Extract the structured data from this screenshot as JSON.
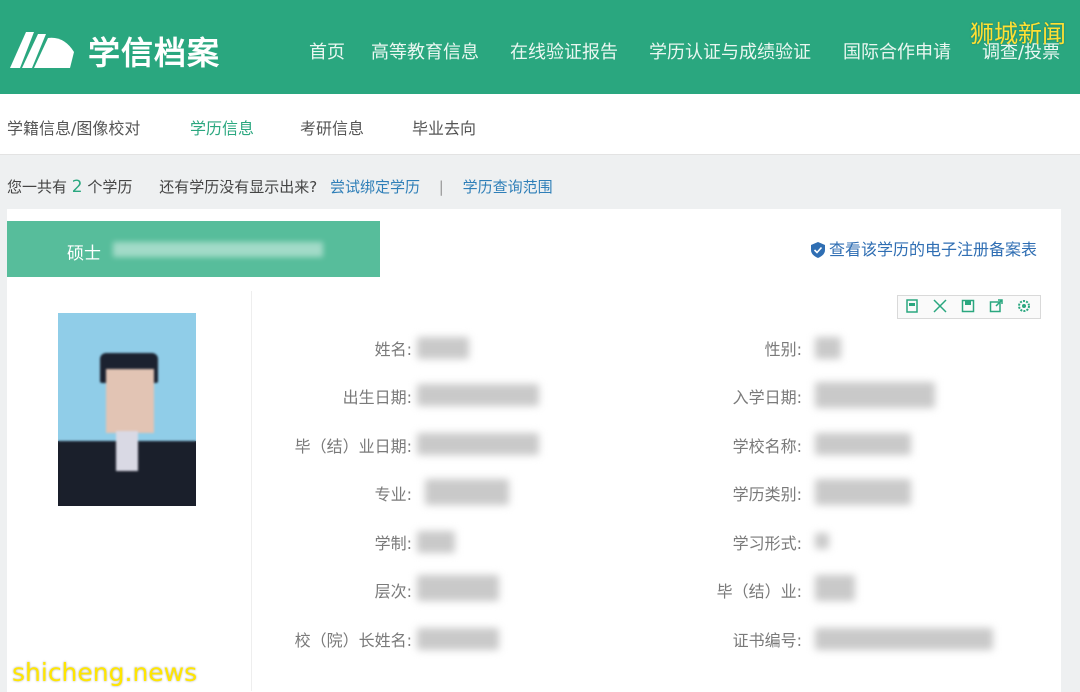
{
  "header": {
    "brand": "学信档案",
    "nav": [
      "首页",
      "高等教育信息",
      "在线验证报告",
      "学历认证与成绩验证",
      "国际合作申请",
      "调查/投票"
    ],
    "watermark": "狮城新闻",
    "accent_color": "#2aa77f"
  },
  "subnav": {
    "items": [
      "学籍信息/图像校对",
      "学历信息",
      "考研信息",
      "毕业去向"
    ],
    "active": "学历信息"
  },
  "summary": {
    "prefix": "您一共有",
    "count": "2",
    "suffix": "个学历",
    "question": "还有学历没有显示出来?",
    "bind_link": "尝试绑定学历",
    "separator": "|",
    "scope_link": "学历查询范围"
  },
  "record": {
    "degree": "硕士",
    "ereg_link": "查看该学历的电子注册备案表",
    "toolbar_icons": [
      "bookmark-icon",
      "fullscreen-icon",
      "save-icon",
      "export-icon",
      "settings-icon"
    ],
    "fields_left": [
      "姓名:",
      "出生日期:",
      "毕（结）业日期:",
      "专业:",
      "学制:",
      "层次:",
      "校（院）长姓名:"
    ],
    "fields_right": [
      "性别:",
      "入学日期:",
      "学校名称:",
      "学历类别:",
      "学习形式:",
      "毕（结）业:",
      "证书编号:"
    ]
  },
  "footer_watermark": "shicheng.news"
}
